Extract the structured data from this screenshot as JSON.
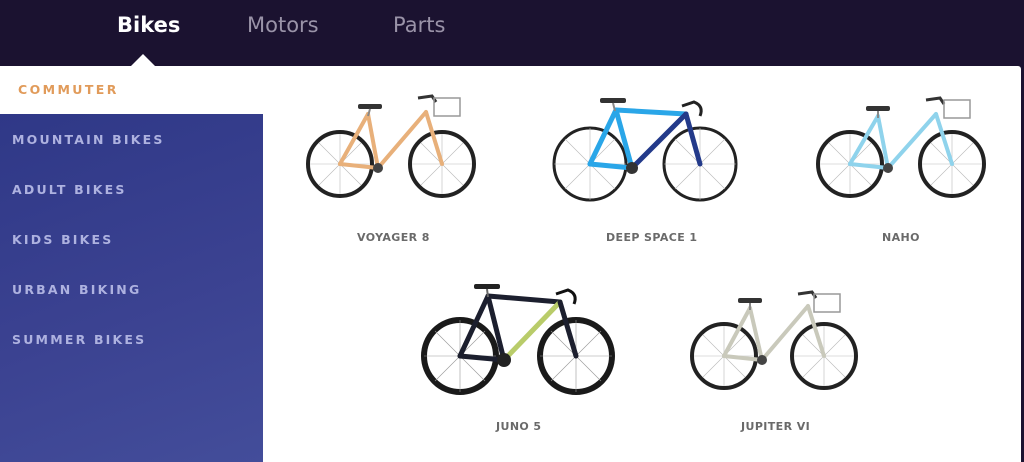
{
  "nav": {
    "tabs": [
      {
        "label": "Bikes",
        "active": true
      },
      {
        "label": "Motors",
        "active": false
      },
      {
        "label": "Parts",
        "active": false
      }
    ]
  },
  "sidebar": {
    "items": [
      {
        "label": "COMMUTER",
        "active": true
      },
      {
        "label": "MOUNTAIN BIKES",
        "active": false
      },
      {
        "label": "ADULT BIKES",
        "active": false
      },
      {
        "label": "KIDS BIKES",
        "active": false
      },
      {
        "label": "URBAN BIKING",
        "active": false
      },
      {
        "label": "SUMMER BIKES",
        "active": false
      }
    ]
  },
  "products": [
    {
      "name": "VOYAGER 8",
      "frame_color": "#e8b07a",
      "style": "step-through-basket"
    },
    {
      "name": "DEEP SPACE 1",
      "frame_color": "#2aa6e8",
      "style": "road"
    },
    {
      "name": "NAHO",
      "frame_color": "#8fd3ec",
      "style": "step-through-basket"
    },
    {
      "name": "JUNO 5",
      "frame_color": "#b9cc6a",
      "style": "road-dark"
    },
    {
      "name": "JUPITER VI",
      "frame_color": "#dcdcd0",
      "style": "step-through-basket"
    }
  ],
  "colors": {
    "topbar": "#1b1230",
    "sidebar": "#343d8c",
    "accent": "#e19b5a"
  }
}
